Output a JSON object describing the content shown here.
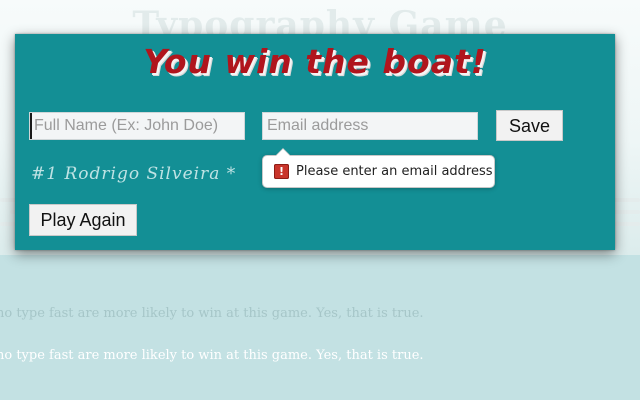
{
  "background": {
    "title": "Typography Game",
    "line_faded": "ho type fast are more likely to win at this game. Yes, that is true.",
    "line_white": "ho type fast are more likely to win at this game. Yes, that is true."
  },
  "modal": {
    "heading": "You win the boat!",
    "name_input": {
      "placeholder": "Full Name (Ex: John Doe)",
      "value": ""
    },
    "email_input": {
      "placeholder": "Email address",
      "value": ""
    },
    "save_label": "Save",
    "rank_text": "#1 Rodrigo Silveira *",
    "play_again_label": "Play Again"
  },
  "validation": {
    "message": "Please enter an email address",
    "icon": "warning-icon",
    "icon_glyph": "!"
  },
  "colors": {
    "modal_bg": "#138f95",
    "heading": "#b0151d",
    "page_bg": "#c3e1e3",
    "warning": "#c9352b"
  }
}
